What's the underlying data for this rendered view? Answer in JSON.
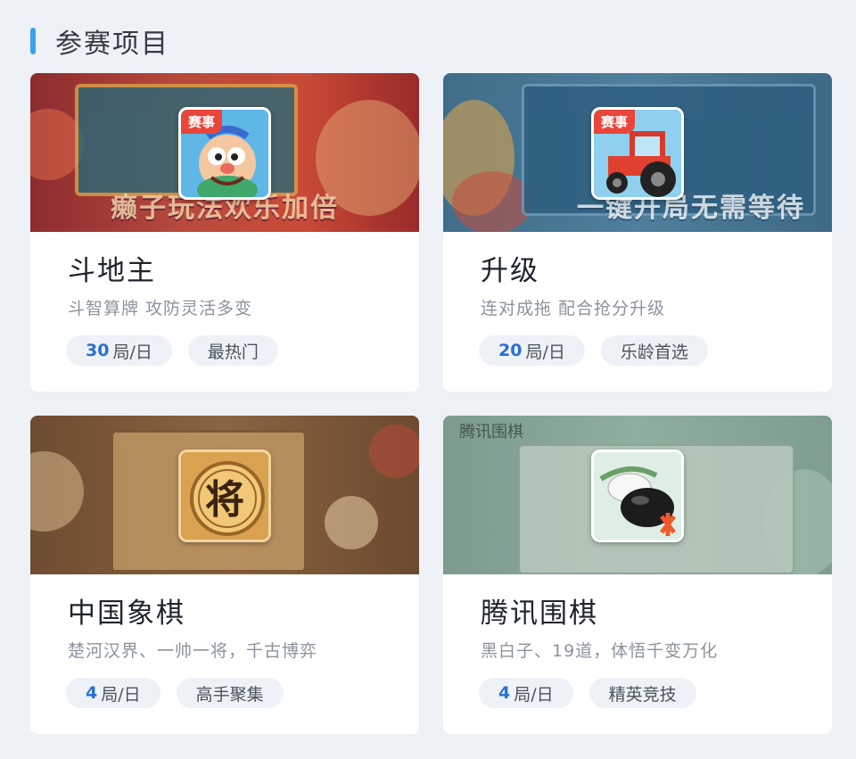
{
  "section": {
    "title": "参赛项目"
  },
  "accent_color": "#3aa0f0",
  "badge_color": "#e9453a",
  "cards": [
    {
      "title": "斗地主",
      "desc": "斗智算牌 攻防灵活多变",
      "count": "30",
      "unit": "局/日",
      "tag": "最热门",
      "badge": "赛事",
      "banner_text": "癞子玩法欢乐加倍",
      "icon": "clown-face-icon"
    },
    {
      "title": "升级",
      "desc": "连对成拖 配合抢分升级",
      "count": "20",
      "unit": "局/日",
      "tag": "乐龄首选",
      "badge": "赛事",
      "banner_text": "一键开局无需等待",
      "icon": "tractor-icon"
    },
    {
      "title": "中国象棋",
      "desc": "楚河汉界、一帅一将，千古博弈",
      "count": "4",
      "unit": "局/日",
      "tag": "高手聚集",
      "badge": "",
      "banner_text": "",
      "icon_text": "将",
      "icon": "xiangqi-piece-icon"
    },
    {
      "title": "腾讯围棋",
      "desc": "黑白子、19道，体悟千变万化",
      "count": "4",
      "unit": "局/日",
      "tag": "精英竞技",
      "badge": "",
      "banner_text": "腾讯围棋",
      "icon": "go-stone-icon"
    }
  ]
}
